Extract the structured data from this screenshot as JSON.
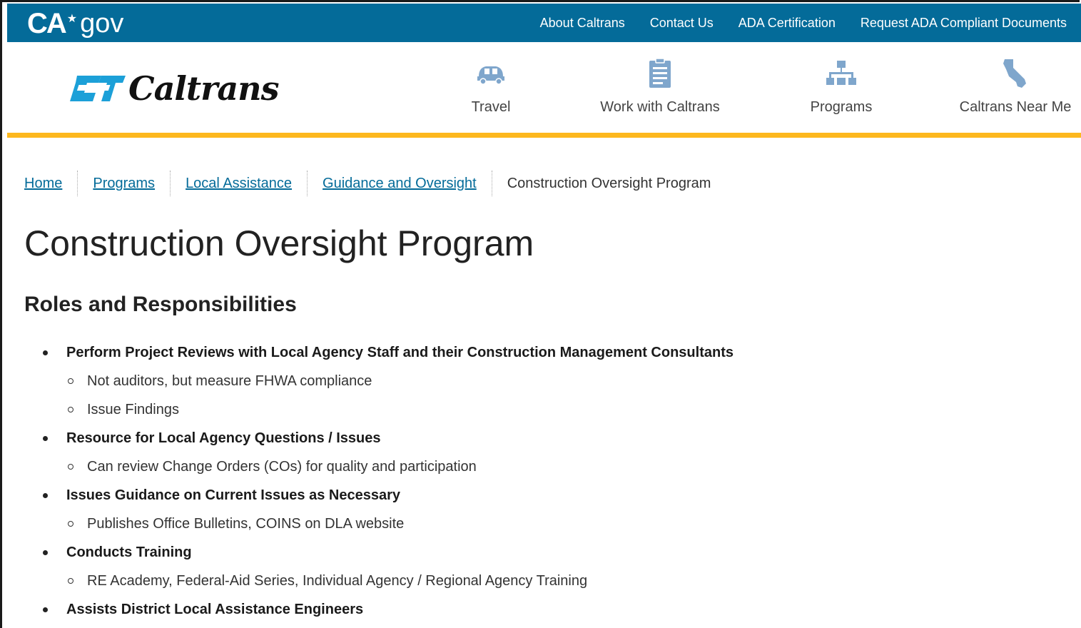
{
  "utility": {
    "logo_ca": "CA",
    "logo_gov": "gov",
    "links": [
      "About Caltrans",
      "Contact Us",
      "ADA Certification",
      "Request ADA Compliant Documents"
    ]
  },
  "header": {
    "brand": "Caltrans",
    "nav": [
      {
        "label": "Travel",
        "icon": "car-icon"
      },
      {
        "label": "Work with Caltrans",
        "icon": "clipboard-icon"
      },
      {
        "label": "Programs",
        "icon": "org-chart-icon"
      },
      {
        "label": "Caltrans Near Me",
        "icon": "california-map-icon"
      }
    ],
    "colors": {
      "utility_bar": "#046b99",
      "accent": "#fdb81e",
      "logo_blue": "#1ca0d8"
    }
  },
  "breadcrumb": {
    "items": [
      "Home",
      "Programs",
      "Local Assistance",
      "Guidance and Oversight"
    ],
    "current": "Construction Oversight Program"
  },
  "main": {
    "title": "Construction Oversight Program",
    "section_heading": "Roles and Responsibilities",
    "roles": [
      {
        "title": "Perform Project Reviews with Local Agency Staff and their Construction Management Consultants",
        "items": [
          "Not auditors, but measure FHWA compliance",
          "Issue Findings"
        ]
      },
      {
        "title": "Resource for Local Agency Questions / Issues",
        "items": [
          "Can review Change Orders (COs) for quality and participation"
        ]
      },
      {
        "title": "Issues Guidance on Current Issues as Necessary",
        "items": [
          "Publishes Office Bulletins, COINS on DLA website"
        ]
      },
      {
        "title": "Conducts Training",
        "items": [
          "RE Academy, Federal-Aid Series, Individual Agency / Regional Agency Training"
        ]
      },
      {
        "title": "Assists District Local Assistance Engineers",
        "items": []
      }
    ]
  }
}
